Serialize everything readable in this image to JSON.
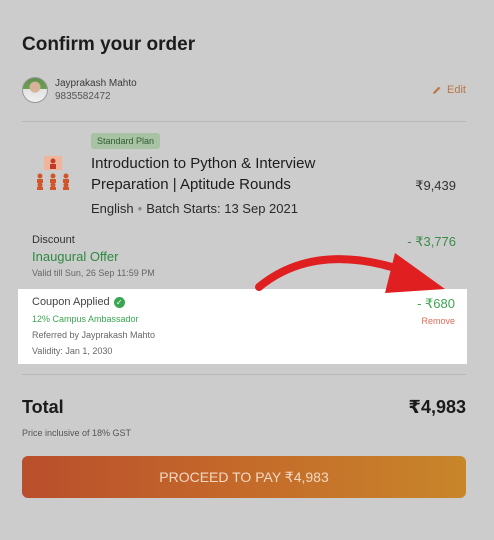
{
  "page": {
    "title": "Confirm your order"
  },
  "user": {
    "name": "Jayprakash Mahto",
    "phone": "9835582472",
    "edit_label": "Edit"
  },
  "course": {
    "plan_badge": "Standard Plan",
    "title": "Introduction to Python & Interview Preparation | Aptitude Rounds",
    "price": "₹9,439",
    "language": "English",
    "batch": "Batch Starts: 13 Sep 2021"
  },
  "discount": {
    "label": "Discount",
    "offer_name": "Inaugural Offer",
    "valid_till": "Valid till Sun, 26 Sep 11:59 PM",
    "amount": "- ₹3,776"
  },
  "coupon": {
    "title": "Coupon Applied",
    "code": "12% Campus Ambassador",
    "referred_by": "Referred by Jayprakash Mahto",
    "validity": "Validity: Jan 1, 2030",
    "amount": "- ₹680",
    "remove_label": "Remove"
  },
  "total": {
    "label": "Total",
    "amount": "₹4,983",
    "note": "Price inclusive of 18% GST"
  },
  "pay_button": {
    "label": "PROCEED TO PAY ₹4,983"
  },
  "colors": {
    "accent_green": "#3aa651",
    "edit_orange": "#b8784a",
    "remove_red": "#e06a5a",
    "annotation_arrow": "#e02020"
  },
  "icons": {
    "edit": "pencil-icon",
    "verified": "check-circle-icon",
    "course": "classroom-icon"
  }
}
